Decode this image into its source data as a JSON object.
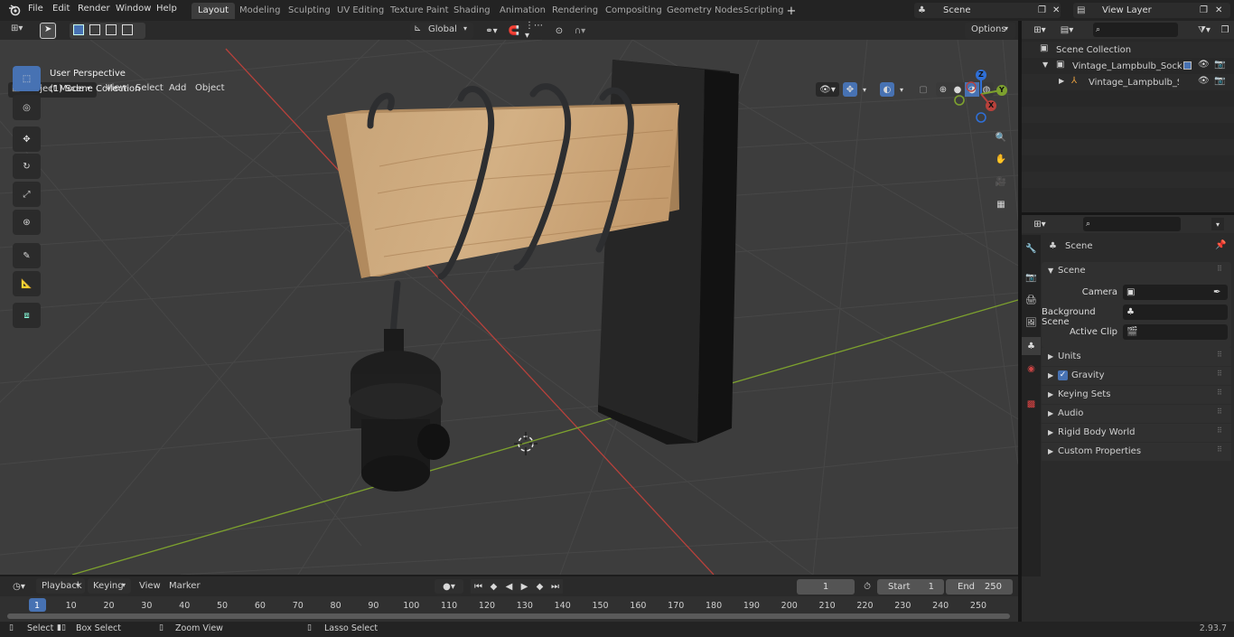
{
  "app": {
    "name": "Blender",
    "version": "2.93.7"
  },
  "topbar": {
    "menus": [
      "File",
      "Edit",
      "Render",
      "Window",
      "Help"
    ],
    "workspaces": [
      "Layout",
      "Modeling",
      "Sculpting",
      "UV Editing",
      "Texture Paint",
      "Shading",
      "Animation",
      "Rendering",
      "Compositing",
      "Geometry Nodes",
      "Scripting"
    ],
    "active_workspace": "Layout",
    "scene_name": "Scene",
    "view_layer_name": "View Layer"
  },
  "viewport": {
    "mode": "Object Mode",
    "menus": [
      "View",
      "Select",
      "Add",
      "Object"
    ],
    "transform_orientation": "Global",
    "options_label": "Options",
    "overlay_line1": "User Perspective",
    "overlay_line2": "(1) Scene Collection",
    "gizmo": {
      "x": "X",
      "y": "Y",
      "z": "Z"
    }
  },
  "tools": [
    "select-box",
    "cursor",
    "move",
    "rotate",
    "scale",
    "transform",
    "annotate",
    "measure",
    "add-cube"
  ],
  "outliner": {
    "root": "Scene Collection",
    "items": [
      {
        "label": "Vintage_Lampbulb_Socket_W",
        "indent": 1
      },
      {
        "label": "Vintage_Lampbulb_Sock",
        "indent": 2
      }
    ]
  },
  "properties": {
    "context_title": "Scene",
    "panel_title": "Scene",
    "fields": [
      {
        "label": "Camera",
        "value": ""
      },
      {
        "label": "Background Scene",
        "value": ""
      },
      {
        "label": "Active Clip",
        "value": ""
      }
    ],
    "sections": [
      "Units",
      "Gravity",
      "Keying Sets",
      "Audio",
      "Rigid Body World",
      "Custom Properties"
    ],
    "gravity_checked": true
  },
  "timeline": {
    "menus": [
      "Playback",
      "Keying",
      "View",
      "Marker"
    ],
    "current_frame": "1",
    "start_label": "Start",
    "start_value": "1",
    "end_label": "End",
    "end_value": "250",
    "ticks": [
      "1",
      "10",
      "20",
      "30",
      "40",
      "50",
      "60",
      "70",
      "80",
      "90",
      "100",
      "110",
      "120",
      "130",
      "140",
      "150",
      "160",
      "170",
      "180",
      "190",
      "200",
      "210",
      "220",
      "230",
      "240",
      "250"
    ]
  },
  "statusbar": {
    "items": [
      "Select",
      "Box Select",
      "Zoom View",
      "Lasso Select"
    ],
    "version": "2.93.7"
  },
  "colors": {
    "accent": "#4772b3",
    "x_axis": "#b8413b",
    "y_axis": "#7da12e",
    "z_axis": "#2f6fd6"
  }
}
